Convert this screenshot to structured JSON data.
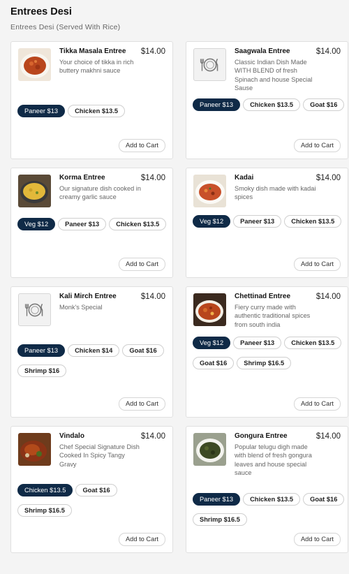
{
  "section": {
    "title": "Entrees Desi",
    "subtitle": "Entrees Desi (Served With Rice)"
  },
  "add_to_cart_label": "Add to Cart",
  "colors": {
    "selected_chip": "#0f2a47"
  },
  "items": [
    {
      "name": "Tikka Masala Entree",
      "price": "$14.00",
      "description": "Your choice of tikka in rich buttery makhni sauce",
      "image": "food-photo",
      "options": [
        {
          "label": "Paneer $13",
          "selected": true
        },
        {
          "label": "Chicken $13.5",
          "selected": false
        }
      ]
    },
    {
      "name": "Saagwala Entree",
      "price": "$14.00",
      "description": "Classic Indian Dish Made WITH BLEND of fresh Spinach and house Special Sause",
      "image": "plate-icon",
      "options": [
        {
          "label": "Paneer $13",
          "selected": true
        },
        {
          "label": "Chicken $13.5",
          "selected": false
        },
        {
          "label": "Goat $16",
          "selected": false
        }
      ]
    },
    {
      "name": "Korma Entree",
      "price": "$14.00",
      "description": "Our signature dish cooked in creamy garlic sauce",
      "image": "food-photo",
      "options": [
        {
          "label": "Veg $12",
          "selected": true
        },
        {
          "label": "Paneer $13",
          "selected": false
        },
        {
          "label": "Chicken $13.5",
          "selected": false
        }
      ]
    },
    {
      "name": "Kadai",
      "price": "$14.00",
      "description": "Smoky dish made with kadai spices",
      "image": "food-photo",
      "options": [
        {
          "label": "Veg $12",
          "selected": true
        },
        {
          "label": "Paneer $13",
          "selected": false
        },
        {
          "label": "Chicken $13.5",
          "selected": false
        }
      ]
    },
    {
      "name": "Kali Mirch Entree",
      "price": "$14.00",
      "description": "Monk's Special",
      "image": "plate-icon",
      "options": [
        {
          "label": "Paneer $13",
          "selected": true
        },
        {
          "label": "Chicken $14",
          "selected": false
        },
        {
          "label": "Goat $16",
          "selected": false
        },
        {
          "label": "Shrimp $16",
          "selected": false
        }
      ]
    },
    {
      "name": "Chettinad Entree",
      "price": "$14.00",
      "description": "Fiery curry made with authentic traditional spices from south india",
      "image": "food-photo",
      "options": [
        {
          "label": "Veg $12",
          "selected": true
        },
        {
          "label": "Paneer $13",
          "selected": false
        },
        {
          "label": "Chicken $13.5",
          "selected": false
        },
        {
          "label": "Goat $16",
          "selected": false
        },
        {
          "label": "Shrimp $16.5",
          "selected": false
        }
      ]
    },
    {
      "name": "Vindalo",
      "price": "$14.00",
      "description": "Chef Special Signature Dish Cooked In Spicy Tangy Gravy",
      "image": "food-photo",
      "options": [
        {
          "label": "Chicken $13.5",
          "selected": true
        },
        {
          "label": "Goat $16",
          "selected": false
        },
        {
          "label": "Shrimp $16.5",
          "selected": false
        }
      ]
    },
    {
      "name": "Gongura Entree",
      "price": "$14.00",
      "description": "Popular telugu digh made with blend of fresh gongura leaves and house special sauce",
      "image": "food-photo",
      "options": [
        {
          "label": "Paneer $13",
          "selected": true
        },
        {
          "label": "Chicken $13.5",
          "selected": false
        },
        {
          "label": "Goat $16",
          "selected": false
        },
        {
          "label": "Shrimp $16.5",
          "selected": false
        }
      ]
    }
  ]
}
